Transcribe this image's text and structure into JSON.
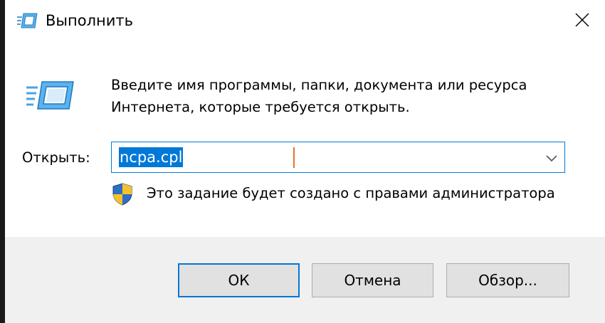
{
  "window": {
    "title": "Выполнить"
  },
  "dialog": {
    "description": "Введите имя программы, папки, документа или ресурса Интернета, которые требуется открыть.",
    "open_label": "Открыть:",
    "input_value": "ncpa.cpl",
    "admin_note": "Это задание будет создано с правами администратора"
  },
  "buttons": {
    "ok_label": "ОК",
    "cancel_label": "Отмена",
    "browse_label": "Обзор..."
  },
  "colors": {
    "accent": "#0078d7",
    "footer_bg": "#f0f0f0",
    "button_bg": "#e1e1e1"
  },
  "icons": {
    "title": "run-icon",
    "close": "close-icon",
    "main": "run-large-icon",
    "dropdown": "chevron-down-icon",
    "admin": "uac-shield-icon"
  }
}
